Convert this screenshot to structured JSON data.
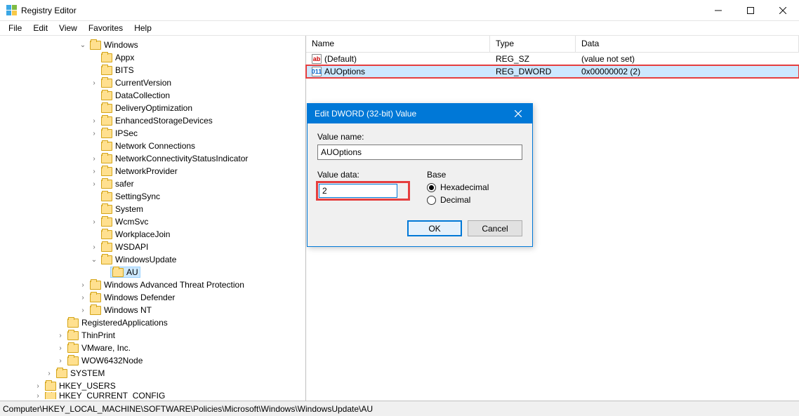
{
  "window": {
    "title": "Registry Editor"
  },
  "menu": {
    "file": "File",
    "edit": "Edit",
    "view": "View",
    "favorites": "Favorites",
    "help": "Help"
  },
  "tree": {
    "windows": "Windows",
    "items": [
      {
        "label": "Appx",
        "exp": false,
        "depth": 8
      },
      {
        "label": "BITS",
        "exp": false,
        "depth": 8
      },
      {
        "label": "CurrentVersion",
        "exp": true,
        "depth": 8
      },
      {
        "label": "DataCollection",
        "exp": false,
        "depth": 8
      },
      {
        "label": "DeliveryOptimization",
        "exp": false,
        "depth": 8
      },
      {
        "label": "EnhancedStorageDevices",
        "exp": true,
        "depth": 8
      },
      {
        "label": "IPSec",
        "exp": true,
        "depth": 8
      },
      {
        "label": "Network Connections",
        "exp": false,
        "depth": 8
      },
      {
        "label": "NetworkConnectivityStatusIndicator",
        "exp": true,
        "depth": 8
      },
      {
        "label": "NetworkProvider",
        "exp": true,
        "depth": 8
      },
      {
        "label": "safer",
        "exp": true,
        "depth": 8
      },
      {
        "label": "SettingSync",
        "exp": false,
        "depth": 8
      },
      {
        "label": "System",
        "exp": false,
        "depth": 8
      },
      {
        "label": "WcmSvc",
        "exp": true,
        "depth": 8
      },
      {
        "label": "WorkplaceJoin",
        "exp": false,
        "depth": 8
      },
      {
        "label": "WSDAPI",
        "exp": true,
        "depth": 8
      },
      {
        "label": "WindowsUpdate",
        "exp": true,
        "depth": 8,
        "open": true
      },
      {
        "label": "AU",
        "exp": false,
        "depth": 9,
        "selected": true
      }
    ],
    "after": [
      {
        "label": "Windows Advanced Threat Protection",
        "depth": 7
      },
      {
        "label": "Windows Defender",
        "depth": 7
      },
      {
        "label": "Windows NT",
        "depth": 7
      }
    ],
    "siblings": [
      {
        "label": "RegisteredApplications",
        "depth": 5,
        "exp": false
      },
      {
        "label": "ThinPrint",
        "depth": 5,
        "exp": true
      },
      {
        "label": "VMware, Inc.",
        "depth": 5,
        "exp": true
      },
      {
        "label": "WOW6432Node",
        "depth": 5,
        "exp": true
      }
    ],
    "roots": [
      {
        "label": "SYSTEM",
        "depth": 4,
        "exp": true
      },
      {
        "label": "HKEY_USERS",
        "depth": 3,
        "exp": true
      },
      {
        "label": "HKEY_CURRENT_CONFIG",
        "depth": 3,
        "exp": true,
        "cut": true
      }
    ]
  },
  "listHeader": {
    "name": "Name",
    "type": "Type",
    "data": "Data"
  },
  "values": [
    {
      "name": "(Default)",
      "type": "REG_SZ",
      "data": "(value not set)",
      "icon": "ab"
    },
    {
      "name": "AUOptions",
      "type": "REG_DWORD",
      "data": "0x00000002 (2)",
      "icon": "dw",
      "highlight": true
    }
  ],
  "dialog": {
    "title": "Edit DWORD (32-bit) Value",
    "valueNameLabel": "Value name:",
    "valueName": "AUOptions",
    "valueDataLabel": "Value data:",
    "valueData": "2",
    "baseLabel": "Base",
    "hex": "Hexadecimal",
    "dec": "Decimal",
    "ok": "OK",
    "cancel": "Cancel"
  },
  "status": {
    "path": "Computer\\HKEY_LOCAL_MACHINE\\SOFTWARE\\Policies\\Microsoft\\Windows\\WindowsUpdate\\AU"
  }
}
